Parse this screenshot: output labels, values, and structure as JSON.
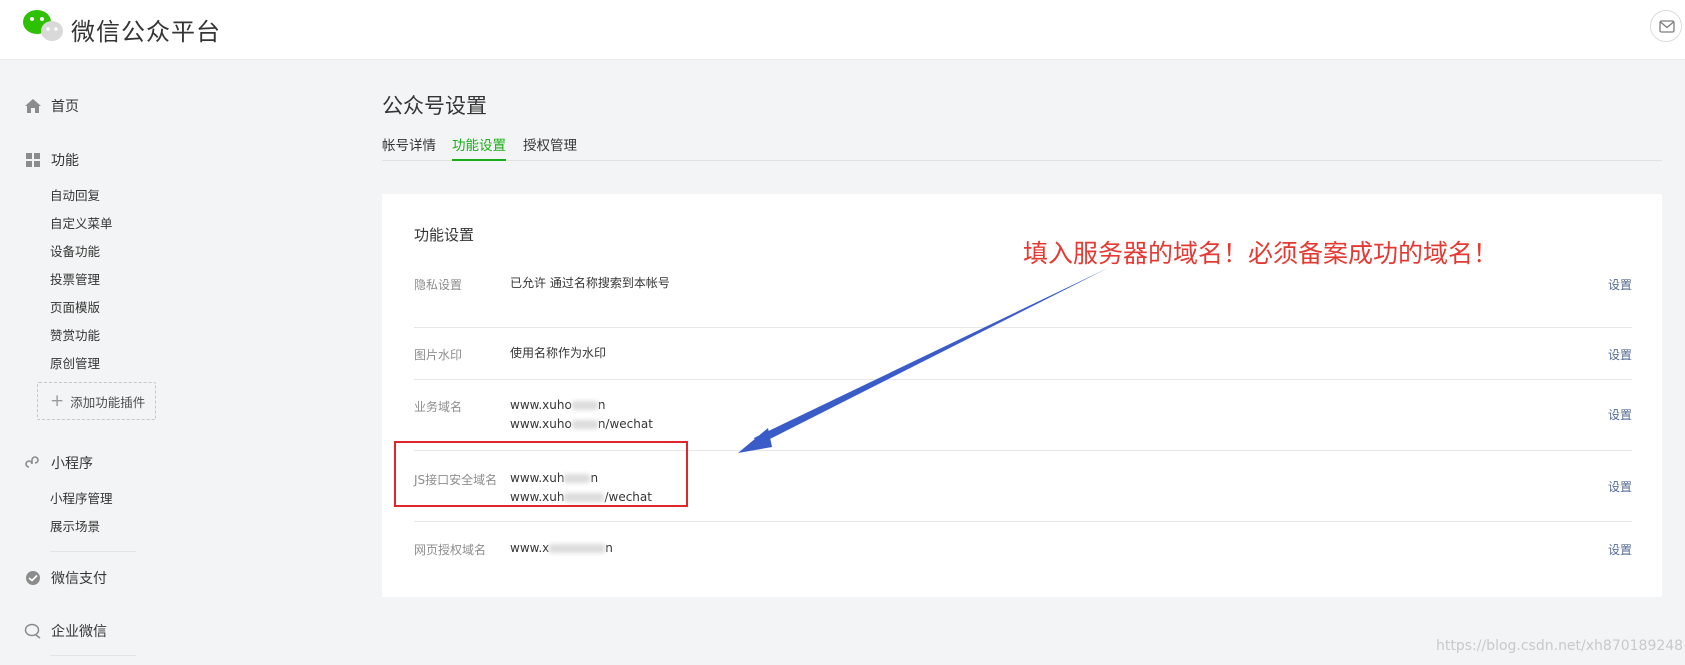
{
  "header": {
    "brand": "微信公众平台",
    "logo_icon": "wechat-logo-icon",
    "mail_icon": "mail-icon"
  },
  "sidebar": {
    "home": {
      "label": "首页",
      "icon": "home-icon"
    },
    "function": {
      "label": "功能",
      "icon": "grid-icon",
      "items": [
        "自动回复",
        "自定义菜单",
        "设备功能",
        "投票管理",
        "页面模版",
        "赞赏功能",
        "原创管理"
      ],
      "add_plugin": "添加功能插件"
    },
    "miniprogram": {
      "label": "小程序",
      "icon": "link-icon",
      "items": [
        "小程序管理",
        "展示场景"
      ]
    },
    "pay": {
      "label": "微信支付",
      "icon": "pay-icon"
    },
    "work": {
      "label": "企业微信",
      "icon": "chat-icon"
    }
  },
  "main": {
    "title": "公众号设置",
    "tabs": [
      {
        "label": "帐号详情",
        "active": false
      },
      {
        "label": "功能设置",
        "active": true
      },
      {
        "label": "授权管理",
        "active": false
      }
    ],
    "card": {
      "title": "功能设置",
      "action_label": "设置",
      "rows": [
        {
          "label": "隐私设置",
          "value": "已允许 通过名称搜索到本帐号"
        },
        {
          "label": "图片水印",
          "value": "使用名称作为水印"
        },
        {
          "label": "业务域名",
          "value_a1": "www.xuho",
          "value_a2": "n",
          "value_b1": "www.xuho",
          "value_b2": "n/wechat"
        },
        {
          "label": "JS接口安全域名",
          "value_a1": "www.xuh",
          "value_a2": "n",
          "value_b1": "www.xuh",
          "value_b2": "/wechat"
        },
        {
          "label": "网页授权域名",
          "value_a1": "www.x",
          "value_a2": "n"
        }
      ]
    }
  },
  "annotation": {
    "text": "填入服务器的域名！必须备案成功的域名！",
    "color": "#e53a33"
  },
  "watermark": "https://blog.csdn.net/xh870189248",
  "colors": {
    "accent_green": "#1aad19",
    "link_blue": "#576b95",
    "highlight_red": "#e0262c",
    "arrow_blue": "#3a5cc9"
  }
}
